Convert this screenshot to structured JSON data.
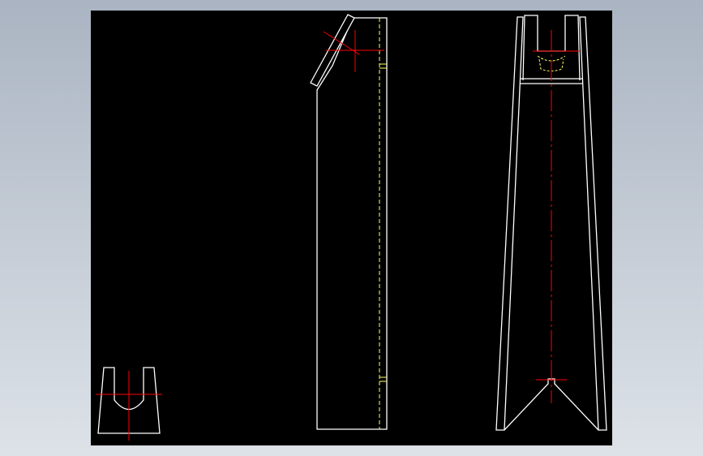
{
  "drawing": {
    "background_color": "#000000",
    "outline_color": "#ffffff",
    "centerline_color": "#ff0000",
    "hidden_line_color": "#ffff66",
    "page_background_top": "#aab4c2",
    "page_background_bottom": "#dde2e8"
  },
  "views": [
    {
      "id": "small-fork-view",
      "description_icon": "fork-outline"
    },
    {
      "id": "side-elevation-view",
      "description_icon": "plate-outline"
    },
    {
      "id": "front-elevation-view",
      "description_icon": "tapered-frame-outline"
    }
  ]
}
